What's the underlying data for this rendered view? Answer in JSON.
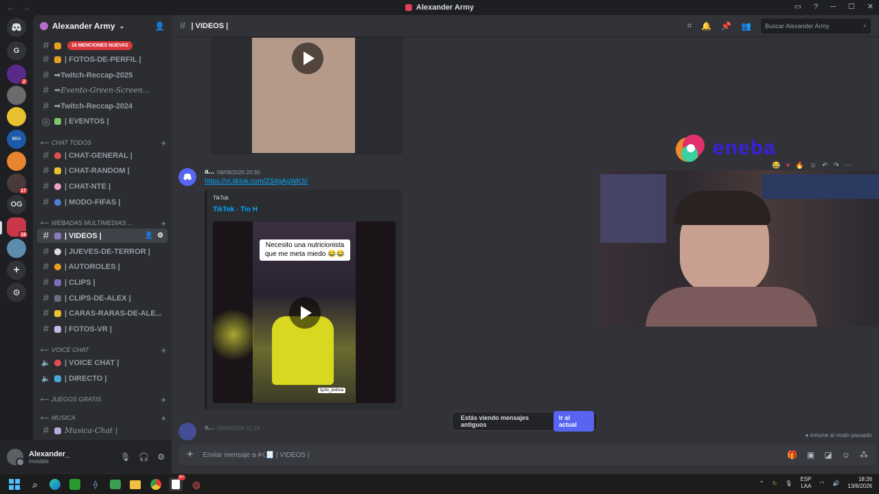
{
  "window": {
    "title": "Alexander Army",
    "controls": [
      "─",
      "☐",
      "✕"
    ]
  },
  "rail": {
    "servers": [
      {
        "label": "G",
        "badge": ""
      },
      {
        "label": "",
        "badge": "2"
      },
      {
        "label": "",
        "badge": ""
      },
      {
        "label": "",
        "badge": ""
      },
      {
        "label": "",
        "badge": ""
      },
      {
        "label": "",
        "badge": ""
      },
      {
        "label": "",
        "badge": "17"
      },
      {
        "label": "OG",
        "badge": ""
      },
      {
        "label": "",
        "badge": "18"
      },
      {
        "label": "",
        "badge": ""
      }
    ]
  },
  "server": {
    "name": "Alexander Army"
  },
  "mentions_banner": "18 MENCIONES NUEVAS",
  "channels": [
    {
      "label": "",
      "type": "text"
    },
    {
      "label": "| FOTOS-DE-PERFIL |",
      "type": "text"
    },
    {
      "label": "➡Twitch-Reccap-2025",
      "type": "text"
    },
    {
      "label": "➡Evento-Green-Screen...",
      "type": "text",
      "italic": true
    },
    {
      "label": "➡Twitch-Reccap-2024",
      "type": "text"
    },
    {
      "label": "| EVENTOS |",
      "type": "stage"
    }
  ],
  "categories": {
    "chat_todos": "CHAT TODOS",
    "webadas": "WEBADAS MULTIMEDIAS ...",
    "voice_chat": "VOICE CHAT",
    "juegos": "JUEGOS GRATIS",
    "musica": "MUSICA"
  },
  "chat_channels": [
    "| CHAT-GENERAL |",
    "| CHAT-RANDOM |",
    "| CHAT-NTE |",
    "| MODO-FIFAS |"
  ],
  "media_channels": [
    "| VIDEOS |",
    "| JUEVES-DE-TERROR |",
    "| AUTOROLES |",
    "| CLIPS |",
    "| CLIPS-DE-ALEX |",
    "| CARAS-RARAS-DE-ALE...",
    "| FOTOS-VR |"
  ],
  "voice_channels": [
    "| VOICE CHAT |",
    "| DIRECTO |"
  ],
  "music_channels": [
    "Musica-Chat |"
  ],
  "user": {
    "name": "Alexander_",
    "status": "Invisible"
  },
  "header": {
    "channel": "| VIDEOS |",
    "search_placeholder": "Buscar Alexander Army"
  },
  "message": {
    "author": "a...",
    "timestamp": "08/08/2026 20:30",
    "link": "https://vt.tiktok.com/ZS4gAgWKS/",
    "embed_provider": "TikTok",
    "embed_title": "TikTok · Tio H",
    "video_caption_1": "Necesito una nutricionista",
    "video_caption_2": "que me meta miedo 😂😂",
    "watermark": "Ig:tio_joshua"
  },
  "next_message": {
    "author": "a...",
    "timestamp": "08/08/2026 21:18"
  },
  "old_messages": {
    "text": "Estás viendo mensajes antiguos",
    "button": "Ir al actual"
  },
  "immune": "Inmune al modo pausado",
  "composer": {
    "placeholder": "Enviar mensaje a #☇🧾 | VIDEOS |"
  },
  "overlay": {
    "brand": "eneba"
  },
  "taskbar": {
    "lang_1": "ESP",
    "lang_2": "LAA",
    "time": "18:26",
    "date": "13/8/2026",
    "badge": "9+"
  },
  "colors": {
    "accent": "#5865f2",
    "mention": "#da373c",
    "link": "#00a8fc",
    "eneba": "#3b1fd9"
  }
}
